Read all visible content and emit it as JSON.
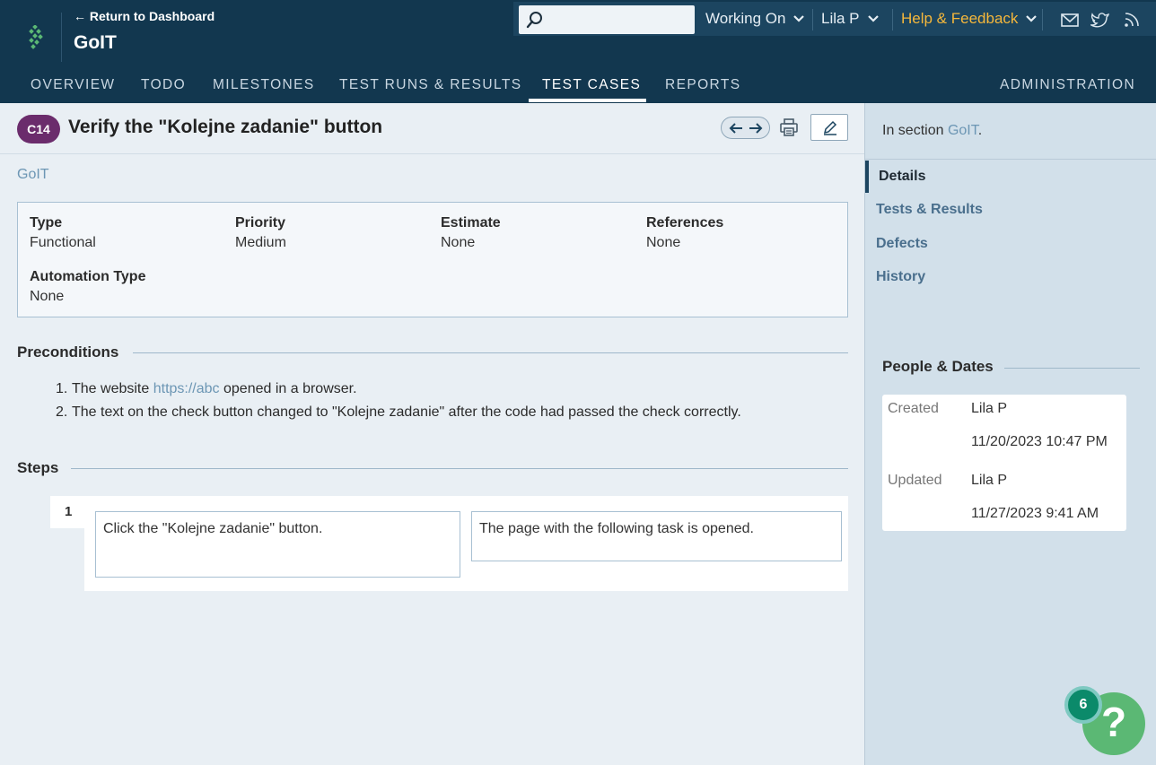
{
  "header": {
    "return_link": "← Return to Dashboard",
    "project_title": "GoIT",
    "search_placeholder": "",
    "working_on": "Working On",
    "user": "Lila P",
    "help": "Help & Feedback",
    "icons": [
      "mail-icon",
      "twitter-icon",
      "rss-icon"
    ]
  },
  "nav": {
    "tabs": [
      "OVERVIEW",
      "TODO",
      "MILESTONES",
      "TEST RUNS & RESULTS",
      "TEST CASES",
      "REPORTS"
    ],
    "active": "TEST CASES",
    "admin": "ADMINISTRATION"
  },
  "case": {
    "id": "C14",
    "title": "Verify the \"Kolejne zadanie\" button",
    "breadcrumb": "GoIT"
  },
  "properties": {
    "type_label": "Type",
    "type_value": "Functional",
    "priority_label": "Priority",
    "priority_value": "Medium",
    "estimate_label": "Estimate",
    "estimate_value": "None",
    "references_label": "References",
    "references_value": "None",
    "automation_label": "Automation Type",
    "automation_value": "None"
  },
  "preconditions": {
    "heading": "Preconditions",
    "item1_prefix": "The website ",
    "item1_link": "https://abc",
    "item1_suffix": " opened in a browser.",
    "item2": "The text on the check button changed to \"Kolejne zadanie\" after the code had passed the check correctly."
  },
  "steps": {
    "heading": "Steps",
    "rows": [
      {
        "number": "1",
        "content": "Click the \"Kolejne zadanie\" button.",
        "expected": "The page with the following task is opened."
      }
    ]
  },
  "sidebar": {
    "in_section_prefix": "In section ",
    "in_section_link": "GoIT",
    "in_section_suffix": ".",
    "tabs": [
      "Details",
      "Tests & Results",
      "Defects",
      "History"
    ],
    "people_heading": "People & Dates",
    "created_label": "Created",
    "created_by": "Lila P",
    "created_date": "11/20/2023 10:47 PM",
    "updated_label": "Updated",
    "updated_by": "Lila P",
    "updated_date": "11/27/2023 9:41 AM"
  },
  "help_widget": {
    "badge_count": "6",
    "symbol": "?"
  },
  "colors": {
    "header_bg": "#12374f",
    "accent_link": "#6c96b4",
    "help_text": "#f5b73b",
    "case_badge": "#6b2c6c",
    "help_bubble": "#5bb874"
  }
}
